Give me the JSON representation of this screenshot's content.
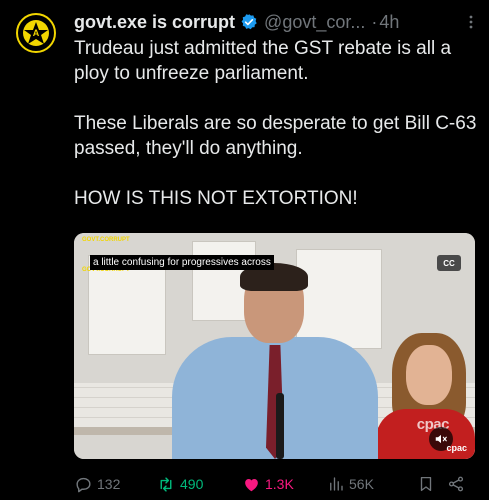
{
  "author": {
    "name": "govt.exe is corrupt",
    "handle": "@govt_cor...",
    "separator": "·",
    "time": "4h"
  },
  "tweet": {
    "paragraphs": [
      "Trudeau just admitted the GST rebate is all a ploy to unfreeze parliament.",
      "These Liberals are so desperate to get Bill C-63 passed, they'll do anything.",
      "HOW IS THIS NOT EXTORTION!"
    ]
  },
  "media": {
    "caption": "a little confusing for progressives across",
    "cc_badge": "CC",
    "watermark": "cpac",
    "watermark_small": "cpac",
    "stamp_top": "GOVT.CORRUPT",
    "stamp_bottom": "GOVT.CORRUPT"
  },
  "actions": {
    "replies": "132",
    "reposts": "490",
    "likes": "1.3K",
    "views": "56K"
  },
  "colors": {
    "background": "#000000",
    "text": "#e7e9ea",
    "muted": "#71767b",
    "verified": "#1d9bf0",
    "repost_active": "#00ba7c",
    "like_active": "#f91880",
    "avatar_accent": "#f2d600"
  },
  "icons": [
    "avatar-logo-icon",
    "verified-badge-icon",
    "more-icon",
    "reply-icon",
    "repost-icon",
    "like-icon",
    "views-icon",
    "bookmark-icon",
    "share-icon",
    "mute-icon"
  ]
}
